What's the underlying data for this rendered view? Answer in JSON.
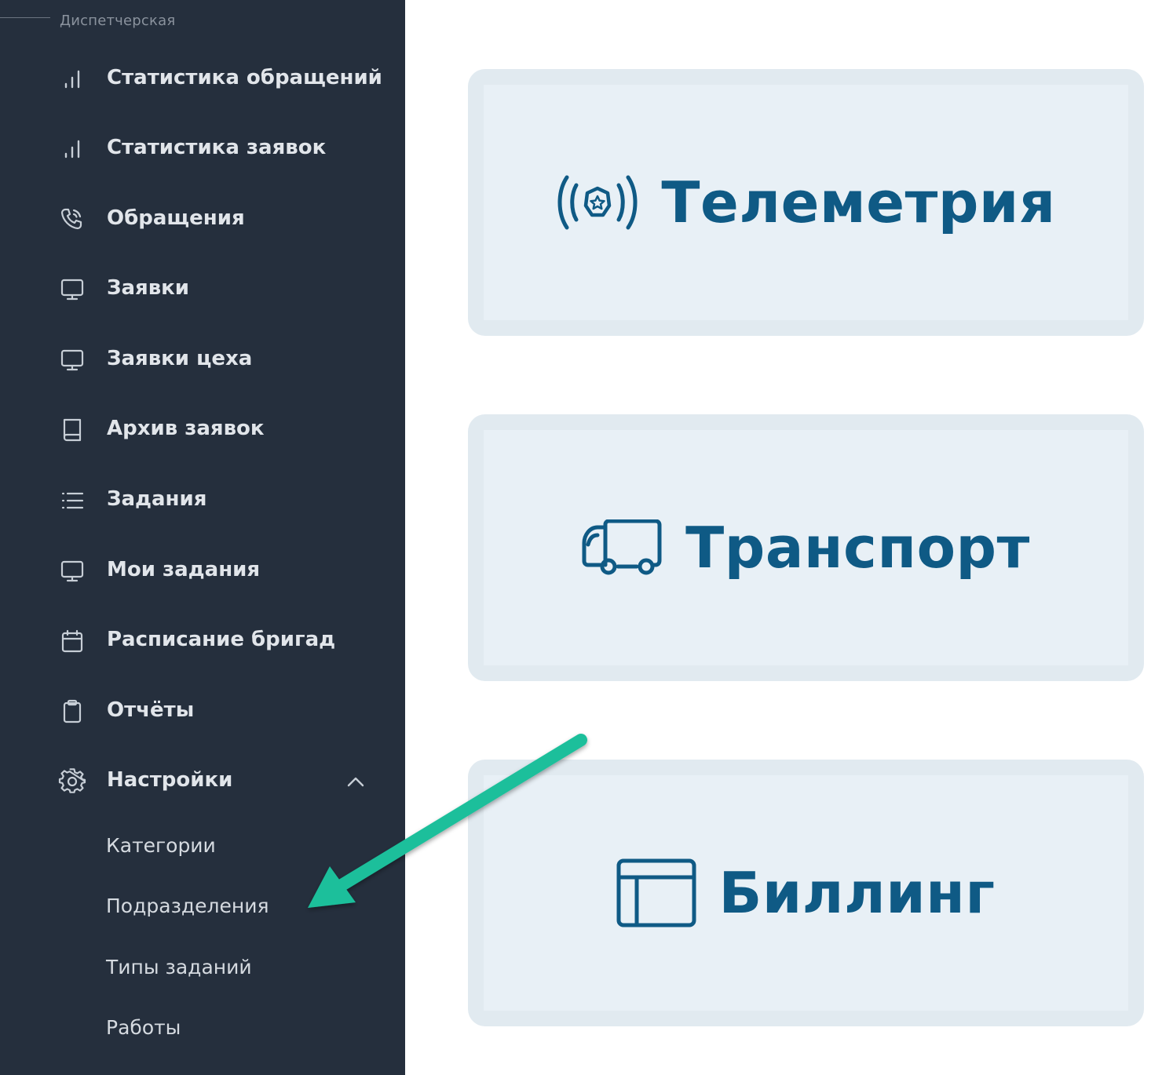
{
  "sidebar": {
    "section_label": "Диспетчерская",
    "items": [
      {
        "label": "Статистика обращений",
        "icon": "bar-chart-icon"
      },
      {
        "label": "Статистика заявок",
        "icon": "bar-chart-icon"
      },
      {
        "label": "Обращения",
        "icon": "phone-call-icon"
      },
      {
        "label": "Заявки",
        "icon": "monitor-icon"
      },
      {
        "label": "Заявки цеха",
        "icon": "monitor-icon"
      },
      {
        "label": "Архив заявок",
        "icon": "book-icon"
      },
      {
        "label": "Задания",
        "icon": "list-icon"
      },
      {
        "label": "Мои задания",
        "icon": "monitor-icon"
      },
      {
        "label": "Расписание бригад",
        "icon": "calendar-icon"
      },
      {
        "label": "Отчёты",
        "icon": "clipboard-icon"
      },
      {
        "label": "Настройки",
        "icon": "gear-icon",
        "expanded": true
      }
    ],
    "settings_subitems": [
      {
        "label": "Категории"
      },
      {
        "label": "Подразделения"
      },
      {
        "label": "Типы заданий"
      },
      {
        "label": "Работы"
      }
    ]
  },
  "cards": [
    {
      "title": "Телеметрия",
      "icon": "telemetry-broadcast-icon"
    },
    {
      "title": "Транспорт",
      "icon": "truck-icon"
    },
    {
      "title": "Биллинг",
      "icon": "billing-window-icon"
    }
  ],
  "colors": {
    "sidebar_bg": "#252f3d",
    "sidebar_text": "#e1e5ea",
    "card_bg": "#e8f0f6",
    "card_border": "#e1eaf0",
    "card_accent": "#0f5a85",
    "annotation_arrow": "#1bbf9b"
  }
}
